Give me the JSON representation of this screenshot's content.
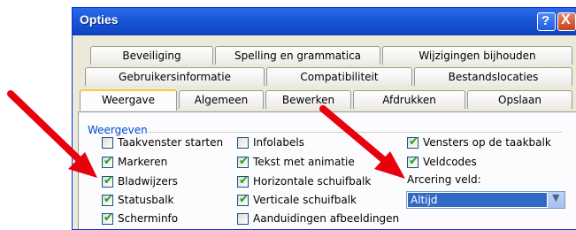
{
  "window": {
    "title": "Opties"
  },
  "titlebar_buttons": {
    "help": "?",
    "close": "X"
  },
  "tabs_row1": [
    "Beveiliging",
    "Spelling en grammatica",
    "Wijzigingen bijhouden"
  ],
  "tabs_row2": [
    "Gebruikersinformatie",
    "Compatibiliteit",
    "Bestandslocaties"
  ],
  "tabs_row3": [
    "Weergave",
    "Algemeen",
    "Bewerken",
    "Afdrukken",
    "Opslaan"
  ],
  "active_tab": "Weergave",
  "group": {
    "title": "Weergeven"
  },
  "checkboxes": [
    {
      "label": "Taakvenster starten",
      "checked": false
    },
    {
      "label": "Markeren",
      "checked": true
    },
    {
      "label": "Bladwijzers",
      "checked": true
    },
    {
      "label": "Statusbalk",
      "checked": true
    },
    {
      "label": "Scherminfo",
      "checked": true
    },
    {
      "label": "Infolabels",
      "checked": false
    },
    {
      "label": "Tekst met animatie",
      "checked": true
    },
    {
      "label": "Horizontale schuifbalk",
      "checked": true
    },
    {
      "label": "Verticale schuifbalk",
      "checked": true
    },
    {
      "label": "Aanduidingen afbeeldingen",
      "checked": false
    },
    {
      "label": "Vensters op de taakbalk",
      "checked": true
    },
    {
      "label": "Veldcodes",
      "checked": true
    }
  ],
  "field_shading": {
    "label": "Arcering veld:",
    "value": "Altijd"
  },
  "check_glyph": "✔",
  "dropdown_glyph": "▼",
  "colors": {
    "arrow": "#e8000d",
    "title_bar": "#1a56d6",
    "group_title": "#0046d5",
    "selection": "#316ac5"
  }
}
